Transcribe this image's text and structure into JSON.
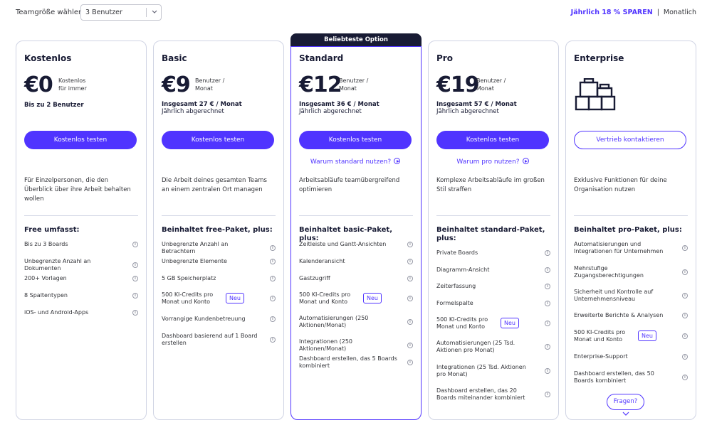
{
  "header": {
    "team_label": "Teamgröße wählen:",
    "team_value": "3 Benutzer",
    "yearly_label": "Jährlich 18 % SPAREN",
    "divider": "|",
    "monthly_label": "Monatlich"
  },
  "badge": "Beliebteste Option",
  "plans": [
    {
      "name": "Kostenlos",
      "price": "€0",
      "price_note_1": "Kostenlos",
      "price_note_2": "für immer",
      "total_line": "Bis zu 2 Benutzer",
      "cta": "Kostenlos testen",
      "description": "Für Einzelpersonen, die den Überblick über ihre Arbeit behalten wollen",
      "includes_title": "Free umfasst:",
      "features": [
        "Bis zu 3 Boards",
        "Unbegrenzte Anzahl an Dokumenten",
        "200+ Vorlagen",
        "8 Spaltentypen",
        "iOS- und Android-Apps"
      ]
    },
    {
      "name": "Basic",
      "price": "€9",
      "price_note_1": "Benutzer /",
      "price_note_2": "Monat",
      "total_bold": "Insgesamt 27 € / Monat",
      "total_sub": "Jährlich abgerechnet",
      "cta": "Kostenlos testen",
      "description": "Die Arbeit deines gesamten Teams an einem zentralen Ort managen",
      "includes_title": "Beinhaltet free-Paket, plus:",
      "features": [
        "Unbegrenzte Anzahl an Betrachtern",
        "Unbegrenzte Elemente",
        "5 GB Speicherplatz",
        "500 KI-Credits pro Monat und Konto",
        "Vorrangige Kundenbetreuung",
        "Dashboard basierend auf 1 Board erstellen"
      ]
    },
    {
      "name": "Standard",
      "price": "€12",
      "price_note_1": "Benutzer /",
      "price_note_2": "Monat",
      "total_bold": "Insgesamt 36 € / Monat",
      "total_sub": "Jährlich abgerechnet",
      "cta": "Kostenlos testen",
      "why_link": "Warum standard nutzen?",
      "description": "Arbeitsabläufe teamübergreifend optimieren",
      "includes_title": "Beinhaltet basic-Paket, plus:",
      "features": [
        "Zeitleiste und Gantt-Ansichten",
        "Kalenderansicht",
        "Gastzugriff",
        "500 KI-Credits pro Monat und Konto",
        "Automatisierungen (250 Aktionen/Monat)",
        "Integrationen (250 Aktionen/Monat)",
        "Dashboard erstellen, das 5 Boards kombiniert"
      ]
    },
    {
      "name": "Pro",
      "price": "€19",
      "price_note_1": "Benutzer /",
      "price_note_2": "Monat",
      "total_bold": "Insgesamt 57 € / Monat",
      "total_sub": "Jährlich abgerechnet",
      "cta": "Kostenlos testen",
      "why_link": "Warum pro nutzen?",
      "description": "Komplexe Arbeitsabläufe im großen Stil straffen",
      "includes_title": "Beinhaltet standard-Paket, plus:",
      "features": [
        "Private Boards",
        "Diagramm-Ansicht",
        "Zeiterfassung",
        "Formelspalte",
        "500 KI-Credits pro Monat und Konto",
        "Automatisierungen (25 Tsd. Aktionen pro Monat)",
        "Integrationen (25 Tsd. Aktionen pro Monat)",
        "Dashboard erstellen, das 20 Boards miteinander kombiniert"
      ]
    },
    {
      "name": "Enterprise",
      "cta": "Vertrieb kontaktieren",
      "description": "Exklusive Funktionen für deine Organisation nutzen",
      "includes_title": "Beinhaltet pro-Paket, plus:",
      "features": [
        "Automatisierungen und Integrationen für Unternehmen",
        "Mehrstufige Zugangsberechtigungen",
        "Sicherheit und Kontrolle auf Unternehmensniveau",
        "Erweiterte Berichte & Analysen",
        "500 KI-Credits pro Monat und Konto",
        "Enterprise-Support",
        "Dashboard erstellen, das 50 Boards kombiniert"
      ]
    }
  ],
  "new_badge": "Neu",
  "info_glyph": "i",
  "fragen": "Fragen?",
  "colors": {
    "accent": "#5034ff",
    "dark": "#181b34",
    "border": "#d0d4e4"
  }
}
